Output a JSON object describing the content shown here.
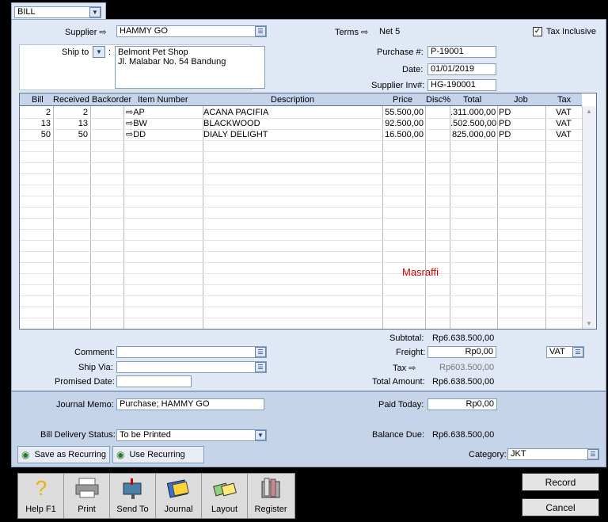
{
  "form_type": "BILL",
  "header": {
    "supplier_label": "Supplier",
    "supplier_value": "HAMMY GO",
    "terms_label": "Terms",
    "terms_value": "Net 5",
    "tax_inclusive_label": "Tax Inclusive",
    "tax_inclusive_checked": "✓",
    "ship_to_label": "Ship to",
    "ship_to_line1": "Belmont Pet Shop",
    "ship_to_line2": "Jl. Malabar No. 54 Bandung",
    "purchase_no_label": "Purchase #:",
    "purchase_no": "P-19001",
    "date_label": "Date:",
    "date": "01/01/2019",
    "supplier_inv_label": "Supplier Inv#:",
    "supplier_inv": "HG-190001"
  },
  "table": {
    "columns": [
      "Bill",
      "Received",
      "Backorder",
      "Item Number",
      "Description",
      "Price",
      "Disc%",
      "Total",
      "Job",
      "Tax"
    ],
    "rows": [
      {
        "bill": "2",
        "received": "2",
        "backorder": "",
        "item": "AP",
        "description": "ACANA PACIFIA",
        "price": "55.500,00",
        "disc": "",
        "total": ".311.000,00",
        "job": "PD",
        "tax": "VAT"
      },
      {
        "bill": "13",
        "received": "13",
        "backorder": "",
        "item": "BW",
        "description": "BLACKWOOD",
        "price": "92.500,00",
        "disc": "",
        "total": ".502.500,00",
        "job": "PD",
        "tax": "VAT"
      },
      {
        "bill": "50",
        "received": "50",
        "backorder": "",
        "item": "DD",
        "description": "DIALY DELIGHT",
        "price": "16.500,00",
        "disc": "",
        "total": "825.000,00",
        "job": "PD",
        "tax": "VAT"
      }
    ],
    "watermark": "Masraffi"
  },
  "footer": {
    "comment_label": "Comment:",
    "ship_via_label": "Ship Via:",
    "promised_date_label": "Promised Date:",
    "subtotal_label": "Subtotal:",
    "subtotal": "Rp6.638.500,00",
    "freight_label": "Freight:",
    "freight": "Rp0,00",
    "freight_tax": "VAT",
    "tax_label": "Tax",
    "tax": "Rp603.500,00",
    "total_label": "Total Amount:",
    "total": "Rp6.638.500,00"
  },
  "bottom": {
    "journal_memo_label": "Journal Memo:",
    "journal_memo": "Purchase; HAMMY GO",
    "paid_today_label": "Paid Today:",
    "paid_today": "Rp0,00",
    "delivery_status_label": "Bill Delivery Status:",
    "delivery_status": "To be Printed",
    "balance_due_label": "Balance Due:",
    "balance_due": "Rp6.638.500,00",
    "save_recurring": "Save as Recurring",
    "use_recurring": "Use Recurring",
    "category_label": "Category:",
    "category": "JKT"
  },
  "toolbar": {
    "help": "Help F1",
    "print": "Print",
    "send_to": "Send To",
    "journal": "Journal",
    "layout": "Layout",
    "register": "Register"
  },
  "actions": {
    "record": "Record",
    "cancel": "Cancel"
  },
  "colors": {
    "panel": "#dfe8f4",
    "panel_dark": "#c6d4ea",
    "watermark": "#d40000"
  }
}
